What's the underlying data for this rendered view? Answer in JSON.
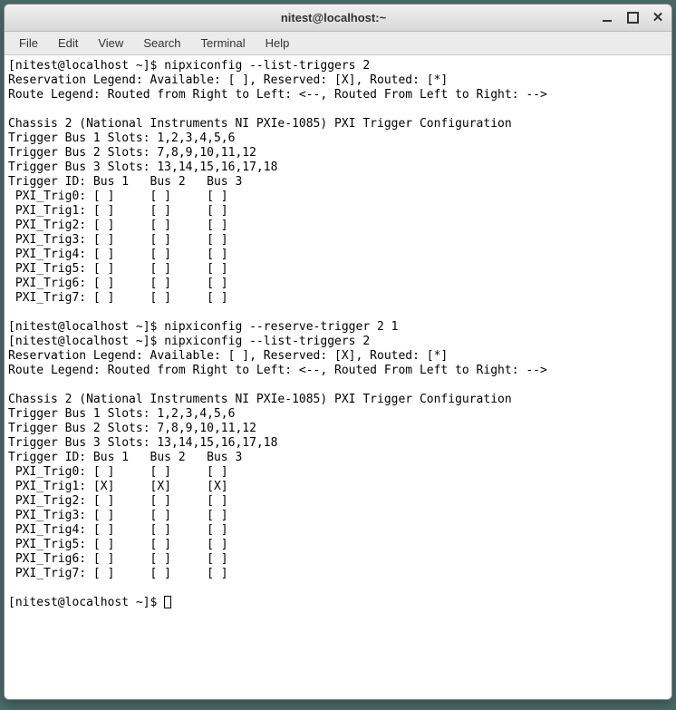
{
  "window": {
    "title": "nitest@localhost:~"
  },
  "menu": {
    "items": [
      "File",
      "Edit",
      "View",
      "Search",
      "Terminal",
      "Help"
    ]
  },
  "terminal": {
    "prompt": "[nitest@localhost ~]$ ",
    "commands": {
      "cmd1": "nipxiconfig --list-triggers 2",
      "cmd2": "nipxiconfig --reserve-trigger 2 1",
      "cmd3": "nipxiconfig --list-triggers 2"
    },
    "block1": {
      "line1": "Reservation Legend: Available: [ ], Reserved: [X], Routed: [*]",
      "line2": "Route Legend: Routed from Right to Left: <--, Routed From Left to Right: -->",
      "line3": "",
      "line4": "Chassis 2 (National Instruments NI PXIe-1085) PXI Trigger Configuration",
      "line5": "Trigger Bus 1 Slots: 1,2,3,4,5,6",
      "line6": "Trigger Bus 2 Slots: 7,8,9,10,11,12",
      "line7": "Trigger Bus 3 Slots: 13,14,15,16,17,18",
      "line8": "Trigger ID: Bus 1   Bus 2   Bus 3",
      "trig0": " PXI_Trig0: [ ]     [ ]     [ ]",
      "trig1": " PXI_Trig1: [ ]     [ ]     [ ]",
      "trig2": " PXI_Trig2: [ ]     [ ]     [ ]",
      "trig3": " PXI_Trig3: [ ]     [ ]     [ ]",
      "trig4": " PXI_Trig4: [ ]     [ ]     [ ]",
      "trig5": " PXI_Trig5: [ ]     [ ]     [ ]",
      "trig6": " PXI_Trig6: [ ]     [ ]     [ ]",
      "trig7": " PXI_Trig7: [ ]     [ ]     [ ]"
    },
    "block2": {
      "line1": "Reservation Legend: Available: [ ], Reserved: [X], Routed: [*]",
      "line2": "Route Legend: Routed from Right to Left: <--, Routed From Left to Right: -->",
      "line3": "",
      "line4": "Chassis 2 (National Instruments NI PXIe-1085) PXI Trigger Configuration",
      "line5": "Trigger Bus 1 Slots: 1,2,3,4,5,6",
      "line6": "Trigger Bus 2 Slots: 7,8,9,10,11,12",
      "line7": "Trigger Bus 3 Slots: 13,14,15,16,17,18",
      "line8": "Trigger ID: Bus 1   Bus 2   Bus 3",
      "trig0": " PXI_Trig0: [ ]     [ ]     [ ]",
      "trig1": " PXI_Trig1: [X]     [X]     [X]",
      "trig2": " PXI_Trig2: [ ]     [ ]     [ ]",
      "trig3": " PXI_Trig3: [ ]     [ ]     [ ]",
      "trig4": " PXI_Trig4: [ ]     [ ]     [ ]",
      "trig5": " PXI_Trig5: [ ]     [ ]     [ ]",
      "trig6": " PXI_Trig6: [ ]     [ ]     [ ]",
      "trig7": " PXI_Trig7: [ ]     [ ]     [ ]"
    }
  }
}
